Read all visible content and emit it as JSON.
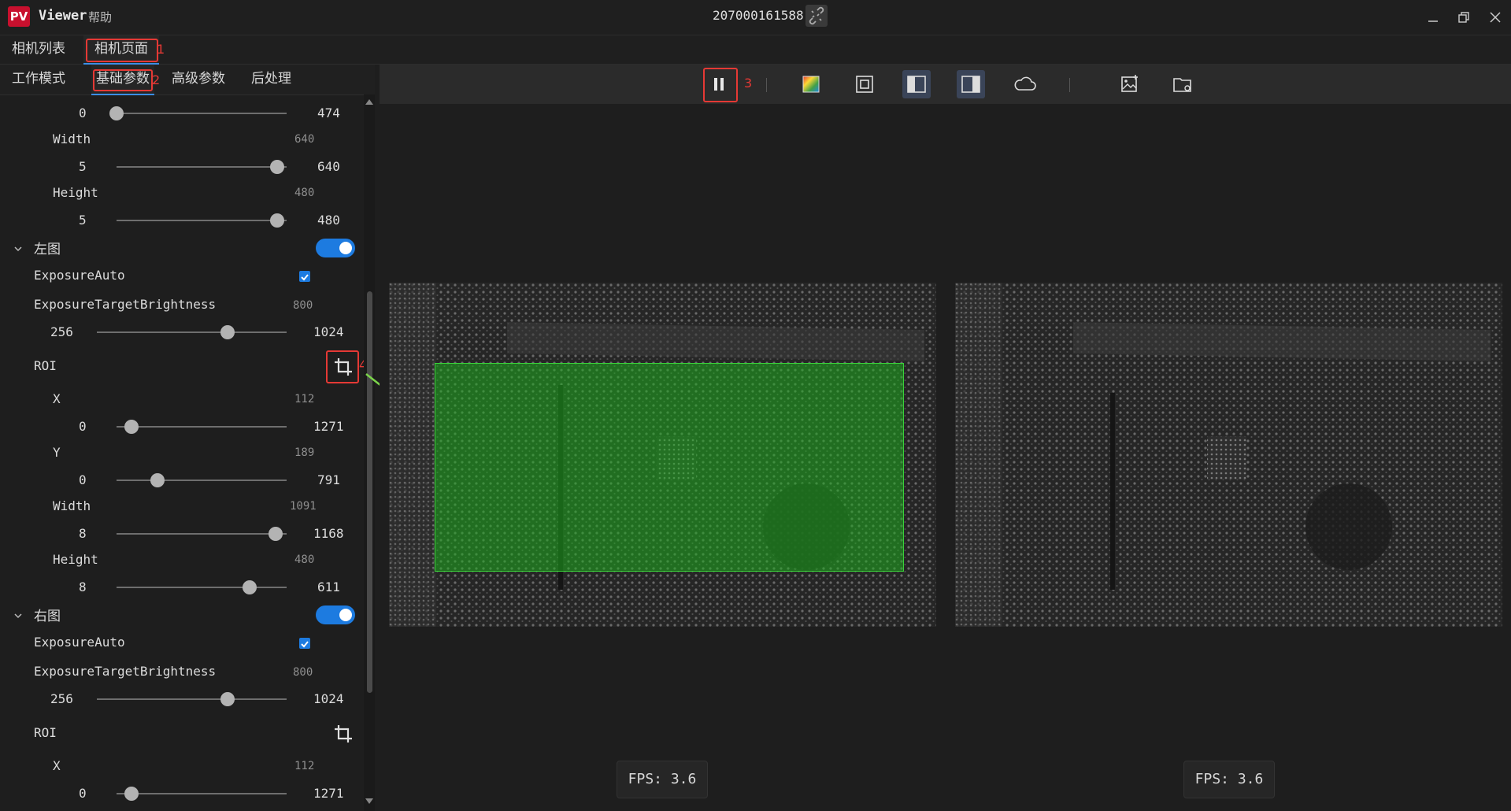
{
  "titlebar": {
    "logo": "PV",
    "app_name": "Viewer",
    "help_menu": "帮助",
    "serial": "207000161588",
    "link_icon": "link-broken-icon"
  },
  "tabs_top": [
    {
      "label": "相机列表"
    },
    {
      "label": "相机页面",
      "active": true
    }
  ],
  "subtabs": [
    {
      "label": "工作模式"
    },
    {
      "label": "基础参数",
      "active": true
    },
    {
      "label": "高级参数"
    },
    {
      "label": "后处理"
    }
  ],
  "annotations": {
    "n1": "1",
    "n2": "2",
    "n3": "3",
    "n4": "4"
  },
  "params": {
    "roi_top_partial": {
      "min": "0",
      "max": "474",
      "pos": 0
    },
    "roi_top_width": {
      "label": "Width",
      "value": "640",
      "min": "5",
      "max": "640",
      "pos": 1.0
    },
    "roi_top_height": {
      "label": "Height",
      "value": "480",
      "min": "5",
      "max": "480",
      "pos": 1.0
    },
    "left_section": {
      "label": "左图",
      "enabled": true
    },
    "left_exposure_auto": {
      "label": "ExposureAuto",
      "checked": true
    },
    "left_brightness": {
      "label": "ExposureTargetBrightness",
      "value": "800",
      "min": "256",
      "max": "1024",
      "pos": 0.6875
    },
    "left_roi": {
      "label": "ROI"
    },
    "left_x": {
      "label": "X",
      "value": "112",
      "min": "0",
      "max": "1271",
      "pos": 0.088
    },
    "left_y": {
      "label": "Y",
      "value": "189",
      "min": "0",
      "max": "791",
      "pos": 0.239
    },
    "left_width": {
      "label": "Width",
      "value": "1091",
      "min": "8",
      "max": "1168",
      "pos": 0.934
    },
    "left_height": {
      "label": "Height",
      "value": "480",
      "min": "8",
      "max": "611",
      "pos": 0.783
    },
    "right_section": {
      "label": "右图",
      "enabled": true
    },
    "right_exposure_auto": {
      "label": "ExposureAuto",
      "checked": true
    },
    "right_brightness": {
      "label": "ExposureTargetBrightness",
      "value": "800",
      "min": "256",
      "max": "1024",
      "pos": 0.6875
    },
    "right_roi": {
      "label": "ROI"
    },
    "right_x": {
      "label": "X",
      "value": "112",
      "min": "0",
      "max": "1271",
      "pos": 0.088
    }
  },
  "toolbar": {
    "icons": [
      "pause-icon",
      "color-map-icon",
      "frame-icon",
      "left-view-icon",
      "right-view-icon",
      "cloud-icon",
      "save-image-icon",
      "open-folder-icon"
    ]
  },
  "fps": {
    "left": "FPS:  3.6",
    "right": "FPS:  3.6"
  },
  "colors": {
    "accent": "#1d7be0",
    "annotation": "#e53935",
    "roi": "#1eaa1e"
  }
}
